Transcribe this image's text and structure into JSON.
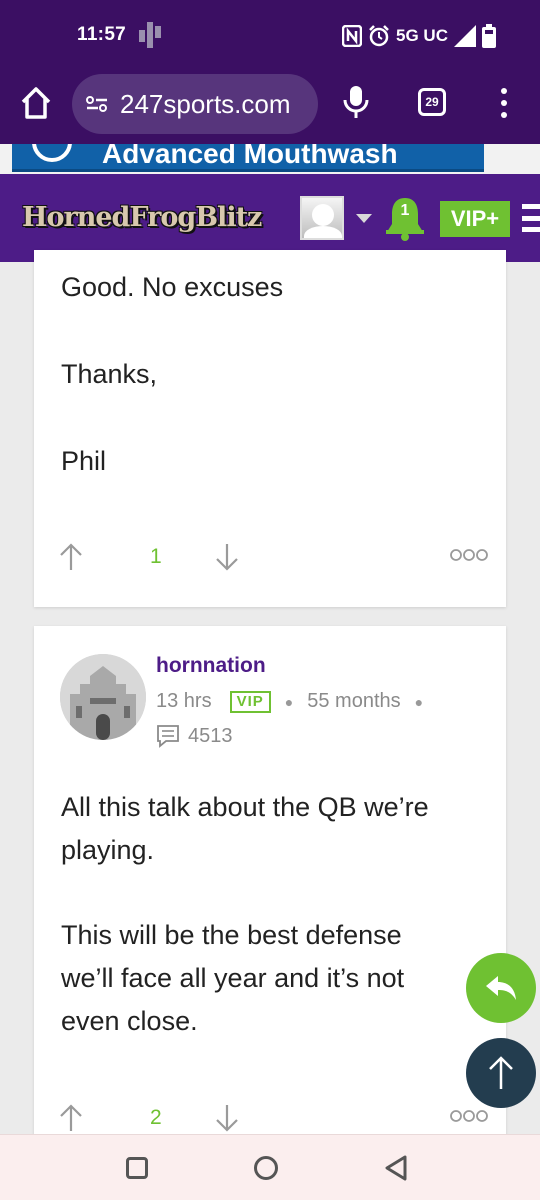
{
  "status_bar": {
    "time": "11:57",
    "network": "5G UC",
    "icons": [
      "nfc-icon",
      "alarm-icon",
      "signal-icon",
      "battery-icon"
    ]
  },
  "browser": {
    "url": "247sports.com",
    "tab_count": "29"
  },
  "ad": {
    "text": "Advanced Mouthwash"
  },
  "site_header": {
    "logo": "HornedFrogBlitz",
    "notification_count": "1",
    "vip_label": "VIP+"
  },
  "posts": [
    {
      "lines": [
        "Good. No excuses",
        "Thanks,",
        "Phil"
      ],
      "upvotes": "1"
    },
    {
      "author": "hornnation",
      "time": "13 hrs",
      "badge": "VIP",
      "tenure": "55 months",
      "post_count": "4513",
      "paragraphs": [
        "All this talk about the QB we’re playing.",
        "This will be the best defense we’ll face all year and it’s not even close."
      ],
      "upvotes": "2"
    }
  ],
  "colors": {
    "brand_purple": "#4d1c87",
    "status_purple": "#3b0f63",
    "accent_green": "#6fc132",
    "scroll_top_dark": "#233d4f"
  }
}
